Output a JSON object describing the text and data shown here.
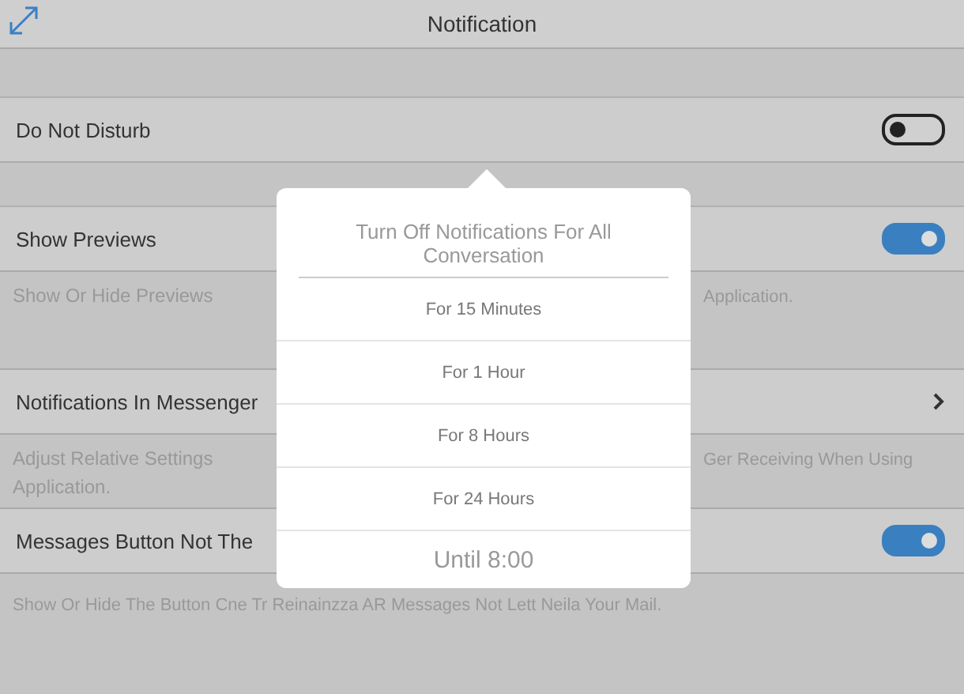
{
  "header": {
    "title": "Notification"
  },
  "rows": [
    {
      "kind": "toggle",
      "label": "Do Not Disturb",
      "on": false,
      "desc_left": [],
      "desc_right": []
    },
    {
      "kind": "toggle",
      "label": "Show Previews",
      "on": true,
      "desc_left": [
        "Show Or Hide Previews"
      ],
      "desc_right": [
        "Application."
      ]
    },
    {
      "kind": "link",
      "label": "Notifications In Messenger",
      "desc_left": [
        "Adjust Relative Settings",
        "Application."
      ],
      "desc_right": [
        "Ger Receiving When Using"
      ]
    },
    {
      "kind": "toggle",
      "label": "Messages Button Not The",
      "on": true,
      "desc_full": "Show Or Hide The Button Cne Tr Reinainzza AR Messages Not Lett Neila Your Mail."
    }
  ],
  "popover": {
    "title": "Turn Off Notifications For All Conversation",
    "options": [
      "For 15 Minutes",
      "For 1 Hour",
      "For 8 Hours",
      "For 24 Hours"
    ],
    "last": "Until 8:00"
  }
}
